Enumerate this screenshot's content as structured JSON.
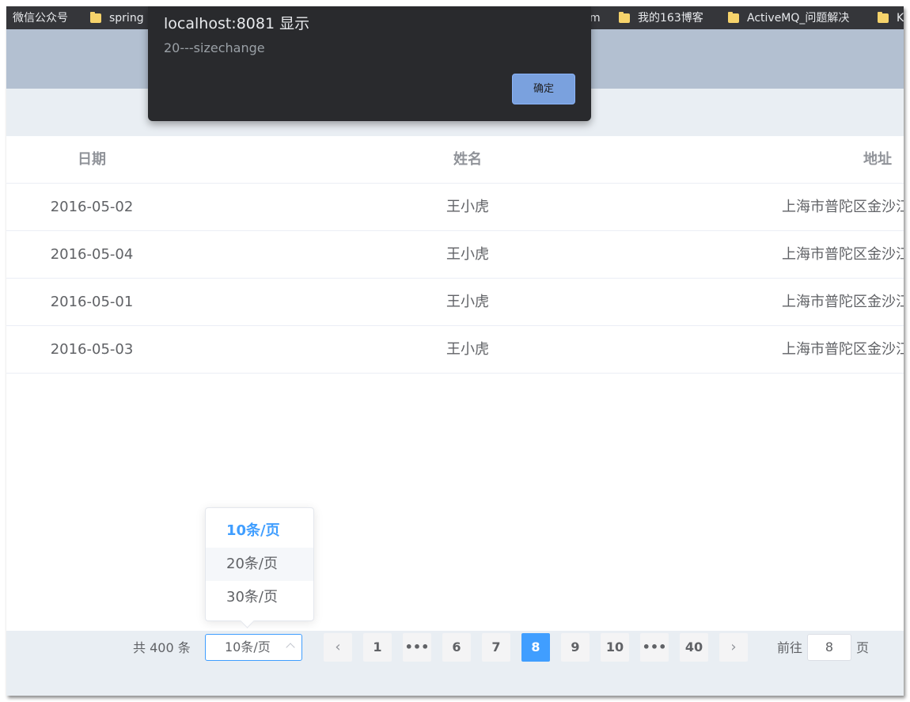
{
  "bookmarks": [
    {
      "label": "微信公众号",
      "folder": false
    },
    {
      "label": "spring",
      "folder": true
    },
    {
      "label": "m",
      "folder": false
    },
    {
      "label": "我的163博客",
      "folder": true
    },
    {
      "label": "ActiveMQ_问题解决",
      "folder": true
    },
    {
      "label": "K",
      "folder": true
    }
  ],
  "alert": {
    "title": "localhost:8081 显示",
    "message": "20---sizechange",
    "ok_label": "确定"
  },
  "table": {
    "headers": [
      "日期",
      "姓名",
      "地址"
    ],
    "rows": [
      {
        "date": "2016-05-02",
        "name": "王小虎",
        "address": "上海市普陀区金沙江"
      },
      {
        "date": "2016-05-04",
        "name": "王小虎",
        "address": "上海市普陀区金沙江"
      },
      {
        "date": "2016-05-01",
        "name": "王小虎",
        "address": "上海市普陀区金沙江"
      },
      {
        "date": "2016-05-03",
        "name": "王小虎",
        "address": "上海市普陀区金沙江"
      }
    ]
  },
  "page_size_dropdown": {
    "options": [
      "10条/页",
      "20条/页",
      "30条/页"
    ],
    "selected": "10条/页",
    "hovered": "20条/页"
  },
  "pagination": {
    "total_label": "共 400 条",
    "page_size_value": "10条/页",
    "prev_icon": "‹",
    "next_icon": "›",
    "pages": [
      "1",
      "•••",
      "6",
      "7",
      "8",
      "9",
      "10",
      "•••",
      "40"
    ],
    "current_page": "8",
    "goto_prefix": "前往",
    "goto_value": "8",
    "goto_suffix": "页"
  },
  "colors": {
    "accent": "#409eff",
    "header": "#b3c0d1",
    "subheader": "#e9eef3",
    "alert_bg": "#292a2d"
  }
}
